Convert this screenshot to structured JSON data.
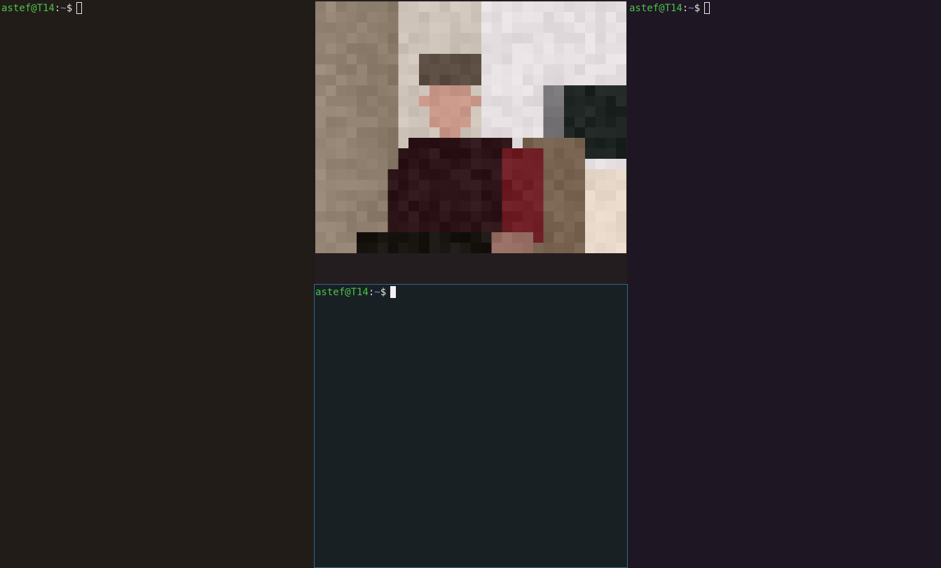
{
  "panes": {
    "left": {
      "prompt": {
        "user_host": "astef@T14",
        "colon": ":",
        "path": "~",
        "dollar": "$"
      },
      "focused": false
    },
    "right": {
      "prompt": {
        "user_host": "astef@T14",
        "colon": ":",
        "path": "~",
        "dollar": "$"
      },
      "focused": false
    },
    "bottom": {
      "prompt": {
        "user_host": "astef@T14",
        "colon": ":",
        "path": "~",
        "dollar": "$"
      },
      "focused": true
    },
    "video": {
      "content": "pixelated webcam feed"
    }
  },
  "colors": {
    "left_bg": "#221c18",
    "right_bg": "#1f1624",
    "video_pane_bg": "#241d1f",
    "bottom_bg": "#192024",
    "focus_border": "#2e6a86",
    "prompt_user": "#4bc34b",
    "prompt_path": "#6f8fd8"
  }
}
